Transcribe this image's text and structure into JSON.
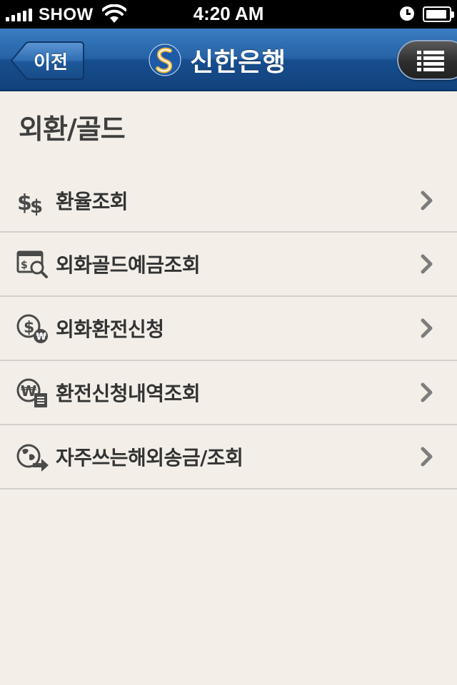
{
  "status_bar": {
    "carrier": "SHOW",
    "time": "4:20 AM"
  },
  "nav": {
    "back_label": "이전",
    "brand_name": "신한은행"
  },
  "page": {
    "title": "외환/골드"
  },
  "menu": [
    {
      "label": "환율조회",
      "icon": "dollar-exchange-icon"
    },
    {
      "label": "외화골드예금조회",
      "icon": "deposit-search-icon"
    },
    {
      "label": "외화환전신청",
      "icon": "currency-exchange-icon"
    },
    {
      "label": "환전신청내역조회",
      "icon": "exchange-history-icon"
    },
    {
      "label": "자주쓰는해외송금/조회",
      "icon": "overseas-remittance-icon"
    }
  ],
  "colors": {
    "nav_blue": "#2662a6",
    "background": "#f3efe8",
    "text": "#333333",
    "divider": "#d3d0cb"
  }
}
